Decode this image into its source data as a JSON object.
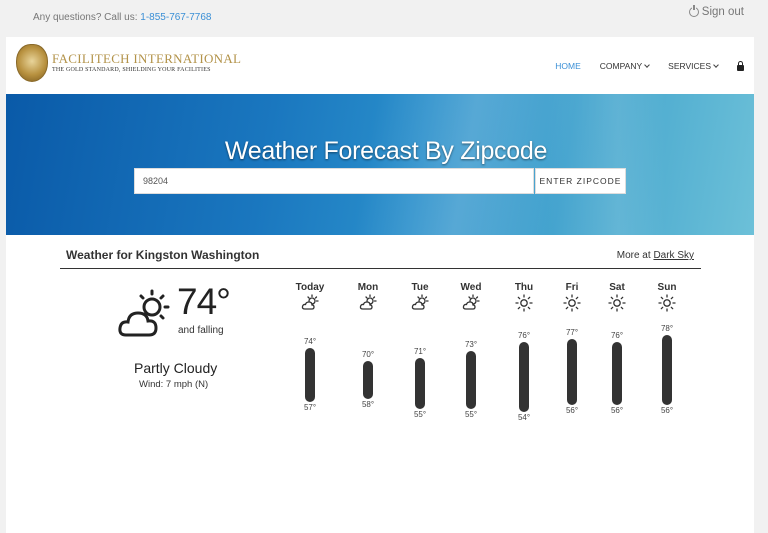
{
  "topbar": {
    "question": "Any questions? Call us: ",
    "phone": "1-855-767-7768",
    "sign_out": "Sign out"
  },
  "brand": {
    "name": "Facilitech International",
    "tagline": "The Gold Standard, Shielding Your Facilities"
  },
  "nav": {
    "home": "HOME",
    "company": "COMPANY",
    "services": "SERVICES"
  },
  "hero": {
    "title": "Weather Forecast By Zipcode",
    "zip_value": "98204",
    "button": "ENTER ZIPCODE"
  },
  "weather": {
    "heading": "Weather for Kingston Washington",
    "more_prefix": "More at ",
    "more_link": "Dark Sky",
    "current": {
      "temp": "74°",
      "trend": "and falling",
      "summary": "Partly Cloudy",
      "wind": "Wind: 7 mph (N)",
      "icon": "partly-cloudy-icon"
    },
    "days": [
      {
        "name": "Today",
        "hi": "74°",
        "lo": "57°",
        "icon": "partly-cloudy-icon"
      },
      {
        "name": "Mon",
        "hi": "70°",
        "lo": "58°",
        "icon": "partly-cloudy-icon"
      },
      {
        "name": "Tue",
        "hi": "71°",
        "lo": "55°",
        "icon": "partly-cloudy-icon"
      },
      {
        "name": "Wed",
        "hi": "73°",
        "lo": "55°",
        "icon": "partly-cloudy-icon"
      },
      {
        "name": "Thu",
        "hi": "76°",
        "lo": "54°",
        "icon": "sun-icon"
      },
      {
        "name": "Fri",
        "hi": "77°",
        "lo": "56°",
        "icon": "sun-icon"
      },
      {
        "name": "Sat",
        "hi": "76°",
        "lo": "56°",
        "icon": "sun-icon"
      },
      {
        "name": "Sun",
        "hi": "78°",
        "lo": "56°",
        "icon": "sun-icon"
      }
    ]
  },
  "colors": {
    "accent": "#3a8fd6",
    "brand_gold": "#b3934a",
    "hero_blue": "#1a77bf"
  }
}
